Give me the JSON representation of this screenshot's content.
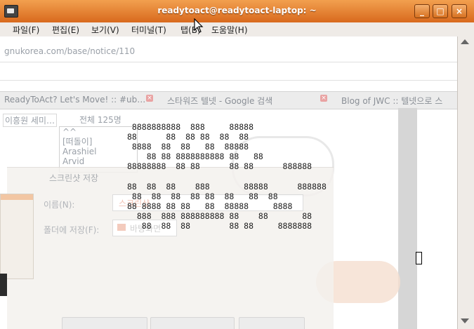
{
  "window": {
    "title": "readytoact@readytoact-laptop: ~",
    "buttons": {
      "minimize": "_",
      "maximize": "□",
      "close": "×"
    }
  },
  "menu": {
    "items": [
      "파일(F)",
      "편집(E)",
      "보기(V)",
      "터미널(T)",
      "탭(B)",
      "도움말(H)"
    ]
  },
  "background": {
    "url": "gnukorea.com/base/notice/110",
    "tabs": [
      "ReadyToAct? Let's Move! :: #ub…",
      "스타워즈 텔넷 - Google 검색",
      "Blog of JWC :: 텔넷으로 스"
    ],
    "member_name": "이흥원 세미…",
    "total_count": "전체 125명",
    "list_items": [
      "^^",
      "[떠돌이]",
      "Arashiel",
      "Arvid"
    ],
    "dialog": {
      "title": "스크린샷 저장",
      "name_label": "이름(N):",
      "name_value": "스크린샷",
      "folder_label": "폴더에 저장(F):",
      "folder_value": "바탕화면"
    }
  },
  "terminal": {
    "ascii_art": " 8888888888  888     88888\n88      88  88 88  88  88\n 8888  88  88   88  88888\n    88 88 8888888888 88   88\n88888888  88 88      88 88      888888\n\n88  88  88    888       88888      888888\n 88  88  88  88 88  88   88  88\n88 8888 88 88   88  88888     8888\n  888  888 888888888 88    88       88\n   88  88  88        88 88     8888888"
  },
  "colors": {
    "titlebar_top": "#f2a04f",
    "titlebar_bottom": "#d8691d",
    "menubar": "#efebe7",
    "terminal_text": "#1e1e1e"
  },
  "icons": [
    "terminal-window-icon",
    "minimize-icon",
    "maximize-icon",
    "close-icon",
    "scroll-up-icon",
    "scroll-down-icon",
    "mouse-pointer-icon"
  ]
}
